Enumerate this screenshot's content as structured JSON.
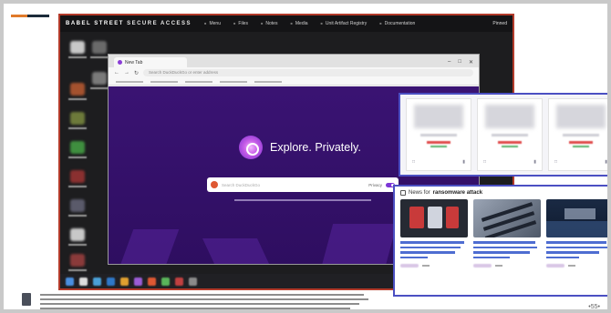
{
  "header": {
    "brand": "BABEL STREET",
    "brand_suffix": "SECURE ACCESS",
    "nav": [
      "Menu",
      "Files",
      "Notes",
      "Media",
      "Unit Artifact Registry",
      "Documentation"
    ],
    "right_label": "Pinned"
  },
  "browser": {
    "tab_title": "New Tab",
    "address_placeholder": "Search DuckDuckGo or enter address",
    "window_controls": [
      "–",
      "□",
      "✕"
    ],
    "nav_buttons": [
      "←",
      "→",
      "↻"
    ]
  },
  "hero": {
    "headline": "Explore. Privately.",
    "search_placeholder": "Search DuckDuckGo",
    "toggle_label": "Privacy"
  },
  "news": {
    "prefix": "News for",
    "query": "ransomware attack"
  },
  "colors": {
    "brand_purple": "#3a1373",
    "accent_orange": "#e07a2a",
    "highlight_border": "#4b4fc2",
    "frame_red": "#b23a2a"
  },
  "page_number": "55"
}
